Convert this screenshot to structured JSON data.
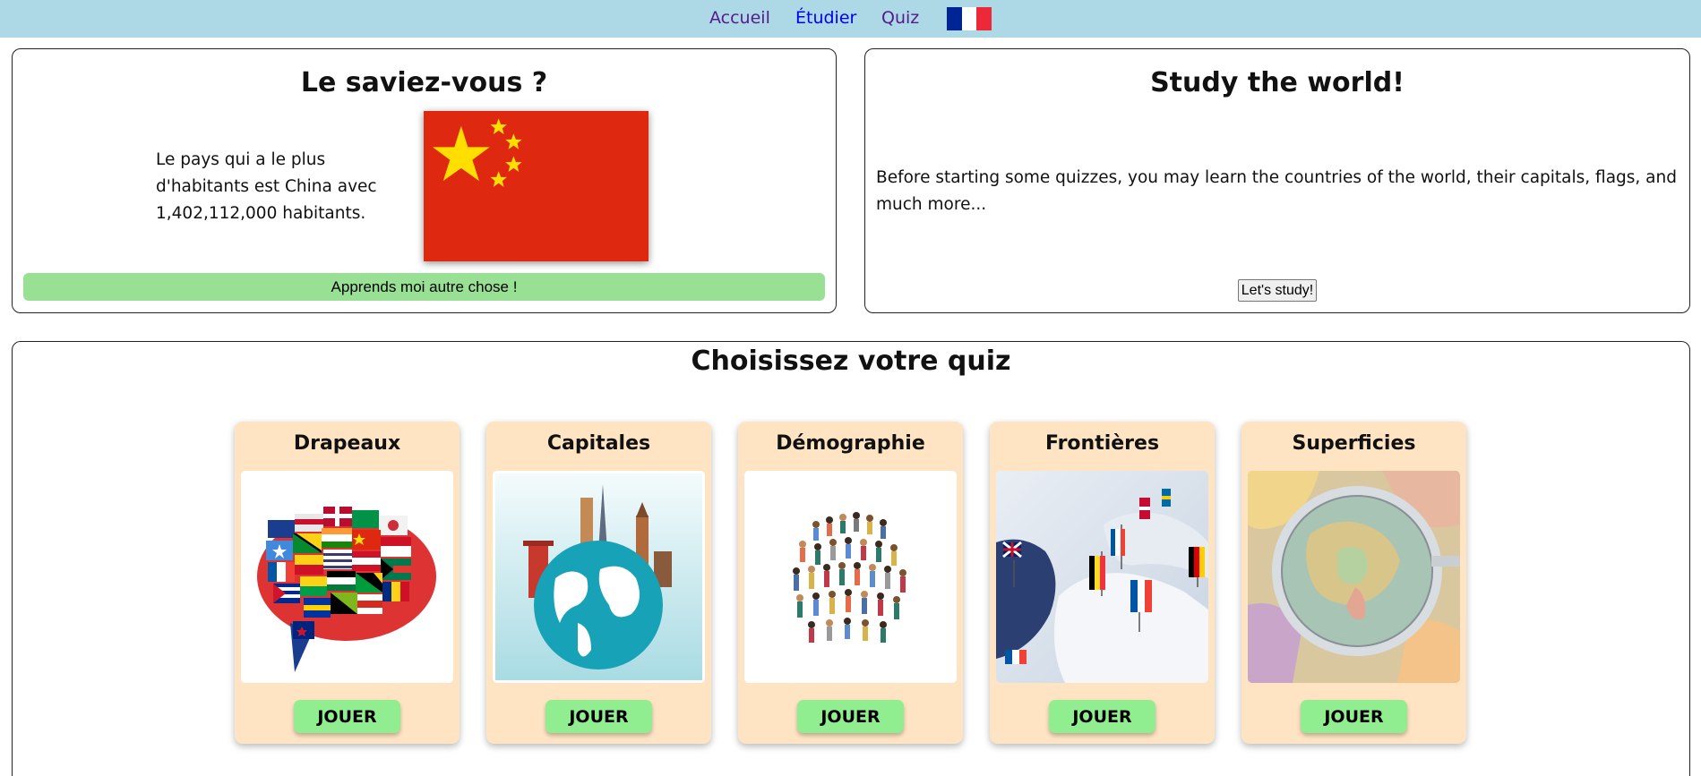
{
  "nav": {
    "items": [
      {
        "label": "Accueil"
      },
      {
        "label": "Étudier"
      },
      {
        "label": "Quiz"
      }
    ],
    "language_flag": {
      "icon": "french-flag-icon",
      "colors": [
        "#002395",
        "#ffffff",
        "#ed2939"
      ]
    }
  },
  "fact": {
    "title": "Le saviez-vous ?",
    "text": "Le pays qui a le plus d'habitants est China avec 1,402,112,000 habitants.",
    "flag_icon": "china-flag-icon",
    "button": "Apprends moi autre chose !"
  },
  "study": {
    "title": "Study the world!",
    "text": "Before starting some quizzes, you may learn the countries of the world, their capitals, flags, and much more...",
    "button": "Let's study!"
  },
  "quiz": {
    "title": "Choisissez votre quiz",
    "cards": [
      {
        "title": "Drapeaux",
        "button": "JOUER",
        "image": "flags-speech-bubble-image"
      },
      {
        "title": "Capitales",
        "button": "JOUER",
        "image": "globe-landmarks-image"
      },
      {
        "title": "Démographie",
        "button": "JOUER",
        "image": "crowd-of-people-image"
      },
      {
        "title": "Frontières",
        "button": "JOUER",
        "image": "map-with-flag-pins-image"
      },
      {
        "title": "Superficies",
        "button": "JOUER",
        "image": "magnifier-over-map-image"
      }
    ]
  },
  "colors": {
    "nav_bg": "#add8e6",
    "card_bg": "#ffe4c4",
    "play_button": "#90ee90",
    "fact_button": "#98e093",
    "china_red": "#de2910",
    "china_yellow": "#ffde00"
  }
}
